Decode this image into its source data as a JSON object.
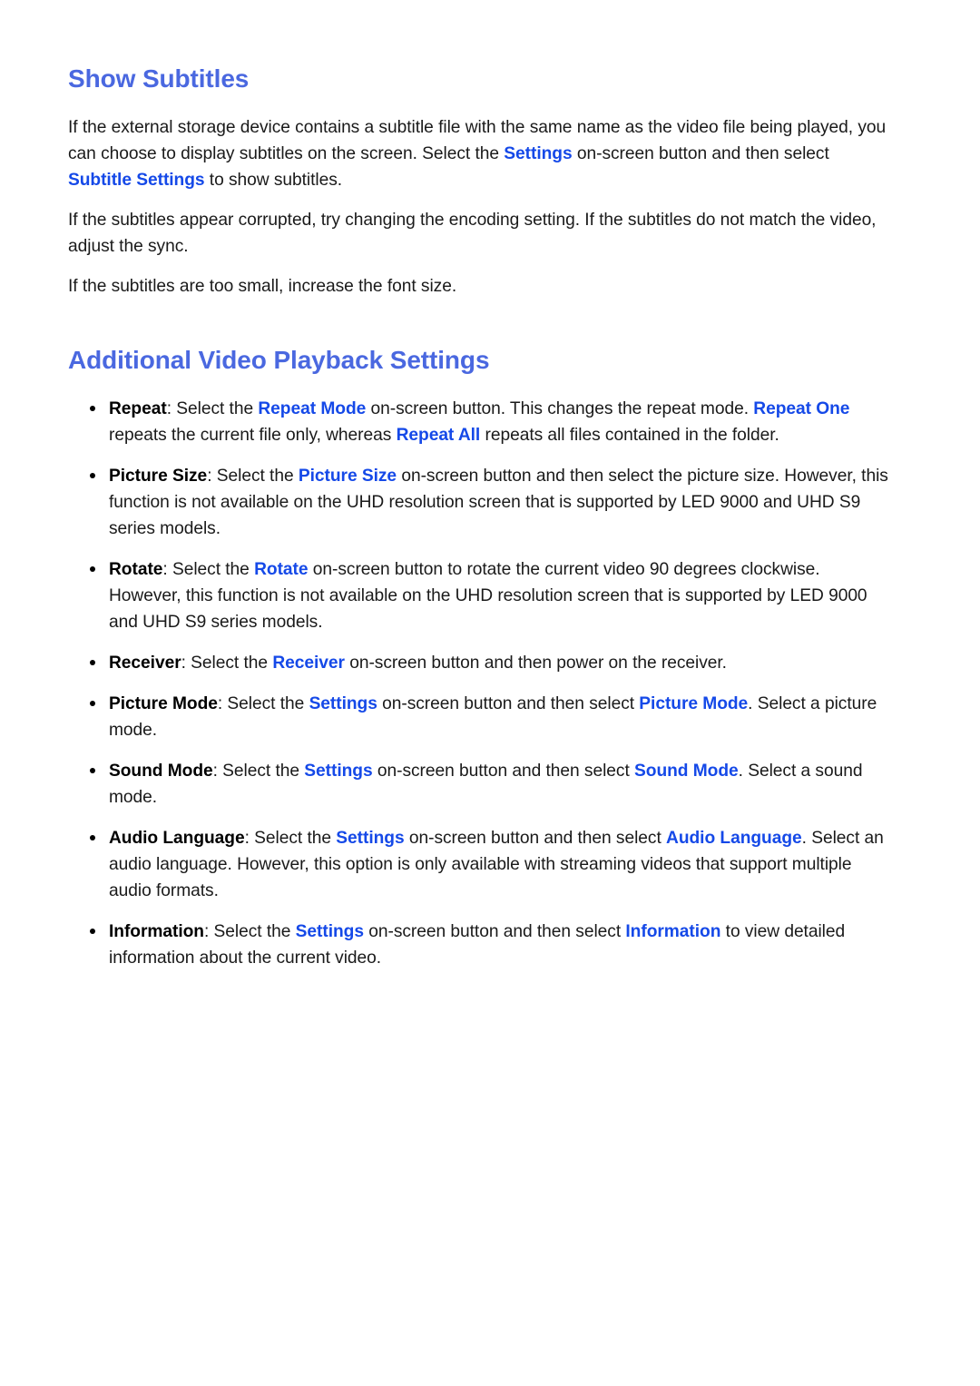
{
  "colors": {
    "heading_blue": "#4a68e0",
    "link_blue": "#1549e8",
    "body_text": "#1a1a1a",
    "background": "#ffffff"
  },
  "sections": {
    "show_subtitles": {
      "heading": "Show Subtitles",
      "paragraphs": {
        "intro": {
          "p1": "If the external storage device contains a subtitle file with the same name as the video file being played, you can choose to display subtitles on the screen. Select the ",
          "link1": "Settings",
          "p2": " on-screen button and then select ",
          "link2": "Subtitle Settings",
          "p3": " to show subtitles."
        },
        "corrupted": "If the subtitles appear corrupted, try changing the encoding setting. If the subtitles do not match the video, adjust the sync.",
        "font_size": "If the subtitles are too small, increase the font size."
      }
    },
    "additional_settings": {
      "heading": "Additional Video Playback Settings",
      "bullets": [
        {
          "term": "Repeat",
          "t1": ": Select the ",
          "link1": "Repeat Mode",
          "t2": " on-screen button. This changes the repeat mode. ",
          "link2": "Repeat One",
          "t3": " repeats the current file only, whereas ",
          "link3": "Repeat All",
          "t4": " repeats all files contained in the folder."
        },
        {
          "term": "Picture Size",
          "t1": ": Select the ",
          "link1": "Picture Size",
          "t2": " on-screen button and then select the picture size. However, this function is not available on the UHD resolution screen that is supported by LED 9000 and UHD S9 series models."
        },
        {
          "term": "Rotate",
          "t1": ": Select the ",
          "link1": "Rotate",
          "t2": " on-screen button to rotate the current video 90 degrees clockwise. However, this function is not available on the UHD resolution screen that is supported by LED 9000 and UHD S9 series models."
        },
        {
          "term": "Receiver",
          "t1": ": Select the ",
          "link1": "Receiver",
          "t2": " on-screen button and then power on the receiver."
        },
        {
          "term": "Picture Mode",
          "t1": ": Select the ",
          "link1": "Settings",
          "t2": " on-screen button and then select ",
          "link2": "Picture Mode",
          "t3": ". Select a picture mode."
        },
        {
          "term": "Sound Mode",
          "t1": ": Select the ",
          "link1": "Settings",
          "t2": " on-screen button and then select ",
          "link2": "Sound Mode",
          "t3": ". Select a sound mode."
        },
        {
          "term": "Audio Language",
          "t1": ": Select the ",
          "link1": "Settings",
          "t2": " on-screen button and then select ",
          "link2": "Audio Language",
          "t3": ". Select an audio language. However, this option is only available with streaming videos that support multiple audio formats."
        },
        {
          "term": "Information",
          "t1": ": Select the ",
          "link1": "Settings",
          "t2": " on-screen button and then select ",
          "link2": "Information",
          "t3": " to view detailed information about the current video."
        }
      ]
    }
  }
}
